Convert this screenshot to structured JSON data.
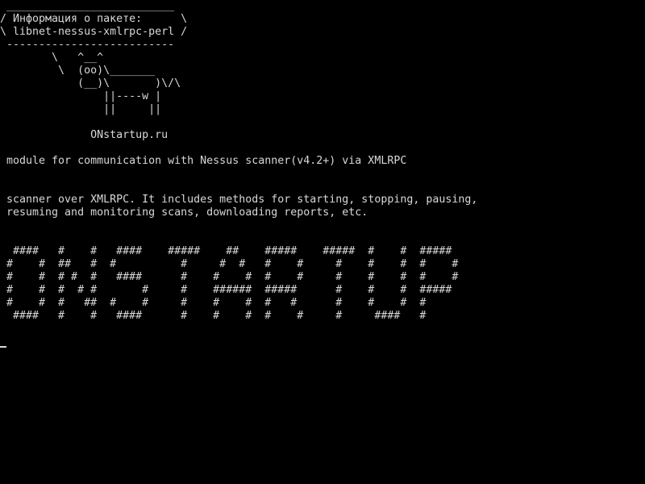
{
  "colors": {
    "background": "#000000",
    "foreground": "#d8d8d8"
  },
  "terminal": {
    "lines": [
      " __________________________",
      "/ Информация о пакете:      \\",
      "\\ libnet-nessus-xmlrpc-perl /",
      " --------------------------",
      "        \\   ^__^",
      "         \\  (oo)\\_______",
      "            (__)\\       )\\/\\",
      "                ||----w |",
      "                ||     ||",
      "",
      "              ONstartup.ru",
      "",
      " module for communication with Nessus scanner(v4.2+) via XMLRPC",
      "",
      "",
      " scanner over XMLRPC. It includes methods for starting, stopping, pausing,",
      " resuming and monitoring scans, downloading reports, etc.",
      "",
      "",
      "  ####   #    #   ####    #####    ##    #####    #####  #    #  #####",
      " #    #  ##   #  #          #     #  #   #    #     #    #    #  #    #",
      " #    #  # #  #   ####      #    #    #  #    #     #    #    #  #    #",
      " #    #  #  # #       #     #    ######  #####      #    #    #  #####",
      " #    #  #   ##  #    #     #    #    #  #   #      #    #    #  #",
      "  ####   #    #   ####      #    #    #  #    #     #     ####   #",
      ""
    ]
  }
}
